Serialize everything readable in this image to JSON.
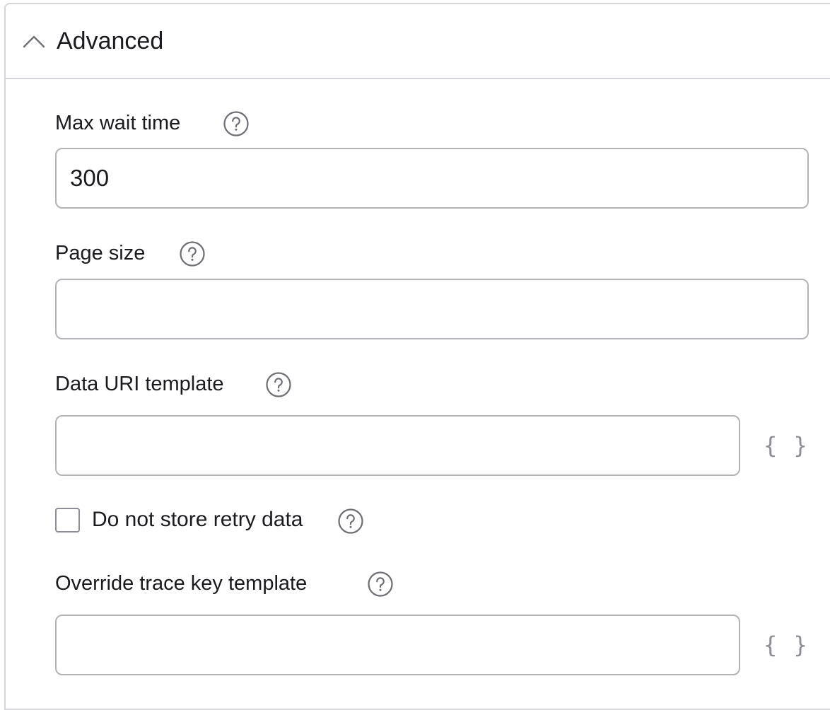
{
  "section": {
    "title": "Advanced",
    "expanded": true,
    "toggle_icon": "chevron-up-icon"
  },
  "fields": {
    "max_wait_time": {
      "label": "Max wait time",
      "value": "300",
      "help_icon": "question-circle-icon"
    },
    "page_size": {
      "label": "Page size",
      "value": "",
      "help_icon": "question-circle-icon"
    },
    "data_uri_template": {
      "label": "Data URI template",
      "value": "",
      "help_icon": "question-circle-icon",
      "template_button": "{ }",
      "template_icon": "curly-braces-icon"
    },
    "do_not_store_retry_data": {
      "label": "Do not store retry data",
      "checked": false,
      "help_icon": "question-circle-icon"
    },
    "override_trace_key_template": {
      "label": "Override trace key template",
      "value": "",
      "help_icon": "question-circle-icon",
      "template_button": "{ }",
      "template_icon": "curly-braces-icon"
    }
  },
  "colors": {
    "border": "#d6d6da",
    "input_border": "#b3b3b8",
    "icon": "#6e6e74",
    "text": "#1b1b1f",
    "muted": "#8e8e94"
  }
}
